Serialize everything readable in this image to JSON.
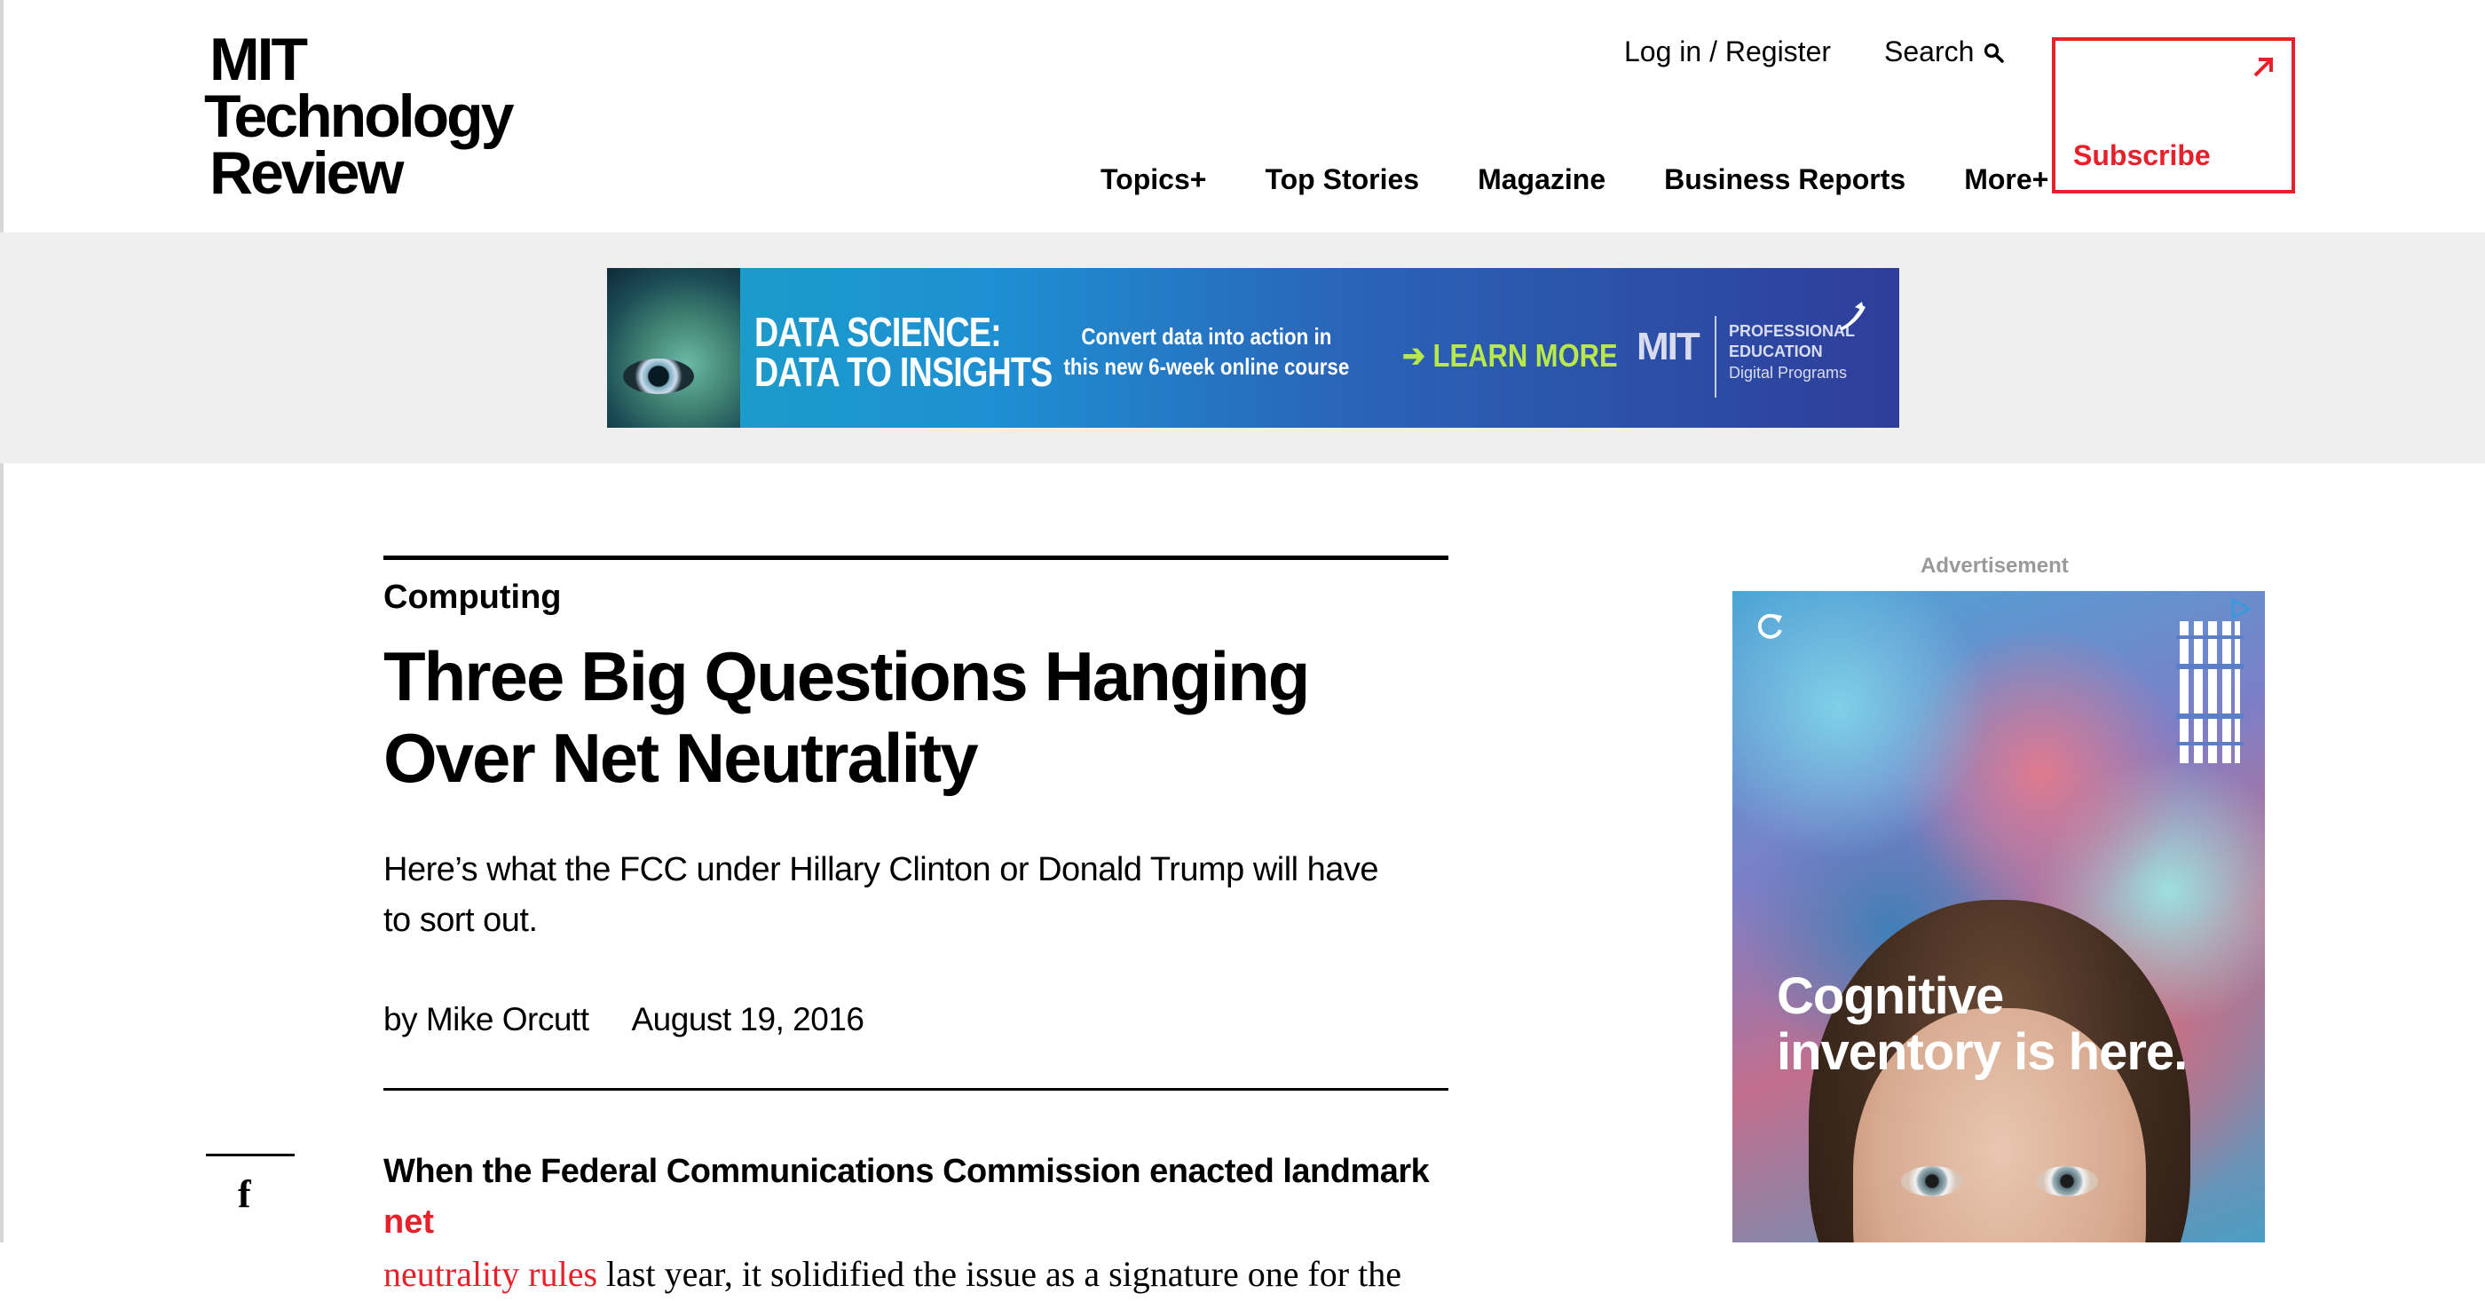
{
  "header": {
    "logo": {
      "line1": "MIT",
      "line2": "Technology",
      "line3": "Review"
    },
    "utility": {
      "login": "Log in / Register",
      "search": "Search"
    },
    "nav": [
      "Topics+",
      "Top Stories",
      "Magazine",
      "Business Reports",
      "More+"
    ],
    "subscribe": "Subscribe"
  },
  "banner": {
    "title_line1": "DATA SCIENCE:",
    "title_line2": "DATA TO INSIGHTS",
    "tag_line1": "Convert data into action in",
    "tag_line2": "this new 6-week online course",
    "cta": "LEARN MORE",
    "org": "MIT",
    "org_line1": "PROFESSIONAL",
    "org_line2": "EDUCATION",
    "org_line3": "Digital Programs"
  },
  "article": {
    "category": "Computing",
    "headline": "Three Big Questions Hanging Over Net Neutrality",
    "dek": "Here’s what the FCC under Hillary Clinton or Donald Trump will have to sort out.",
    "author": "by Mike Orcutt",
    "date": "August 19, 2016",
    "body": {
      "lead": "When the Federal Communications Commission enacted landmark ",
      "link1": "net",
      "link2": "neutrality rules",
      "rest": " last year, it solidified the issue as a signature one for the"
    }
  },
  "sidebar": {
    "ad_label": "Advertisement",
    "ad_copy_line1": "Cognitive",
    "ad_copy_line2": "inventory is here."
  },
  "colors": {
    "accent": "#e8202a",
    "band": "#efefef"
  }
}
